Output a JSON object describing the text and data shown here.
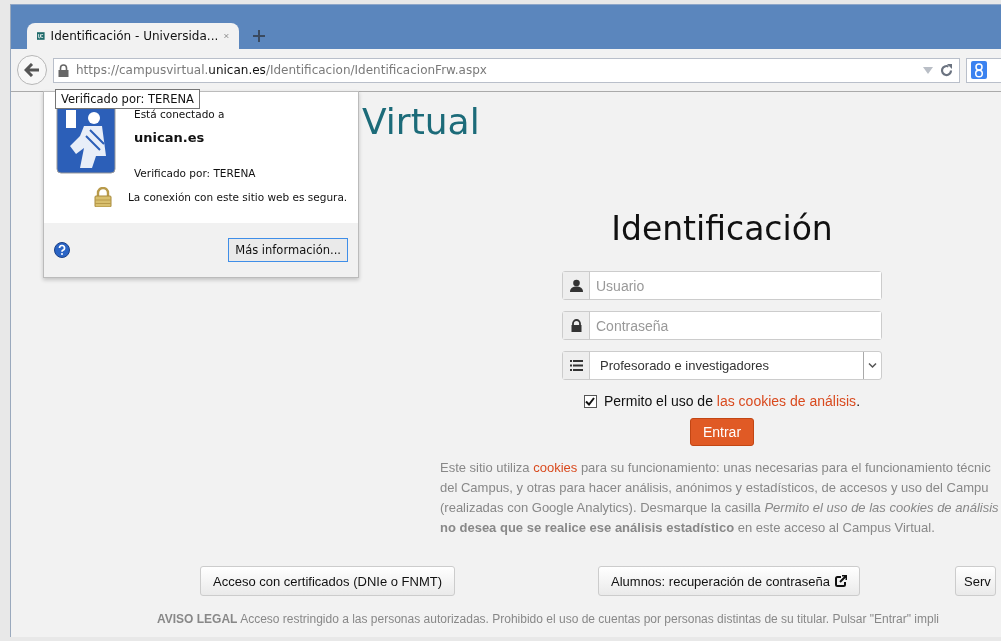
{
  "browser": {
    "tab": {
      "title": "Identificación - Universida...",
      "selected": true
    },
    "address": {
      "scheme": "https://",
      "pre": "campusvirtual.",
      "domain": "unican.es",
      "path": "/Identificacion/IdentificacionFrw.aspx"
    }
  },
  "tooltip": "Verificado por: TERENA",
  "identity_popup": {
    "connected_label": "Está conectado a",
    "host": "unican.es",
    "verifier": "Verificado por: TERENA",
    "security": "La conexión con este sitio web es segura.",
    "more_button": "Más información..."
  },
  "site_title": "Virtual",
  "login": {
    "heading": "Identificación",
    "fields": [
      {
        "kind": "text",
        "placeholder": "Usuario"
      },
      {
        "kind": "password",
        "placeholder": "Contraseña"
      },
      {
        "kind": "select",
        "value": "Profesorado e investigadores"
      }
    ],
    "consent": {
      "checked": true,
      "text": "Permito el uso de ",
      "link": "las cookies de análisis",
      "end": "."
    },
    "submit": "Entrar"
  },
  "cookie_notice": [
    [
      {
        "text": "Este sitio utiliza "
      },
      {
        "text": "cookies",
        "kind": "link"
      },
      {
        "text": " para su funcionamiento: unas necesarias para el funcionamiento técnic"
      }
    ],
    [
      {
        "text": "del Campus, y otras para hacer análisis, anónimos y estadísticos, de accesos y uso del Campu"
      }
    ],
    [
      {
        "text": "(realizadas con Google Analytics). Desmarque la casilla *Permito el uso de las cookies de análisis*"
      }
    ],
    [
      {
        "text": "**no desea que se realice ese análisis estadístico** en este acceso al Campus Virtual."
      }
    ]
  ],
  "buttons": [
    {
      "label": "Acceso con certificados (DNIe o FNMT)",
      "external": false
    },
    {
      "label": "Alumnos: recuperación de contraseña",
      "external": true
    },
    {
      "label": "Serv",
      "external": false
    }
  ],
  "legal": {
    "title": "AVISO LEGAL",
    "text": "Acceso restringido a las personas autorizadas. Prohibido el uso de cuentas por personas distintas de su titular. Pulsar \"Entrar\" impli"
  }
}
